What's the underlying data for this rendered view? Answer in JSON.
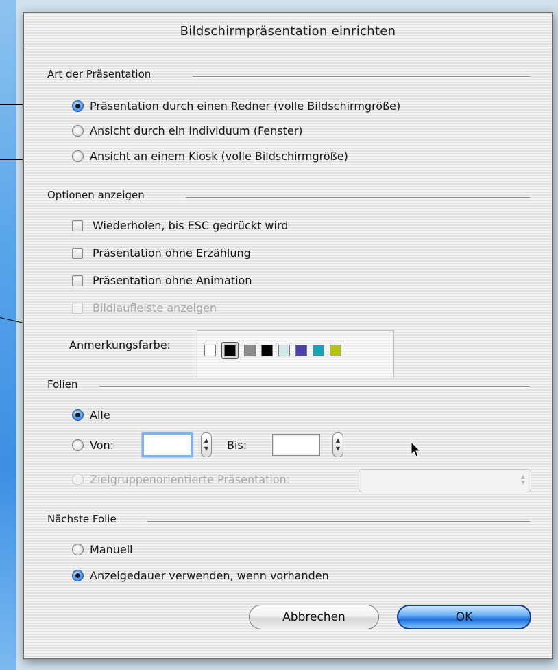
{
  "dialog": {
    "title": "Bildschirmpräsentation einrichten"
  },
  "presentation_type": {
    "title": "Art der Präsentation",
    "options": [
      {
        "label": "Präsentation durch einen Redner (volle Bildschirmgröße)",
        "checked": true
      },
      {
        "label": "Ansicht durch ein Individuum (Fenster)",
        "checked": false
      },
      {
        "label": "Ansicht an einem Kiosk (volle Bildschirmgröße)",
        "checked": false
      }
    ]
  },
  "display_options": {
    "title": "Optionen anzeigen",
    "checkboxes": [
      {
        "label": "Wiederholen, bis ESC gedrückt wird",
        "checked": false,
        "enabled": true
      },
      {
        "label": "Präsentation ohne Erzählung",
        "checked": false,
        "enabled": true
      },
      {
        "label": "Präsentation ohne Animation",
        "checked": false,
        "enabled": true
      },
      {
        "label": "Bildlaufleiste anzeigen",
        "checked": false,
        "enabled": false
      }
    ],
    "annotation_color_label": "Anmerkungsfarbe:",
    "annotation_colors": [
      "#ffffff",
      "#000000",
      "#8c8c8c",
      "#000000",
      "#cfeae6",
      "#4a40a8",
      "#18a3b0",
      "#b5c21a"
    ],
    "selected_color_index": 1
  },
  "slides": {
    "title": "Folien",
    "all_label": "Alle",
    "from_label": "Von:",
    "to_label": "Bis:",
    "from_value": "",
    "to_value": "",
    "custom_show_label": "Zielgruppenorientierte Präsentation:",
    "custom_show_value": "",
    "selected": "all"
  },
  "advance": {
    "title": "Nächste Folie",
    "manual_label": "Manuell",
    "timings_label": "Anzeigedauer verwenden, wenn vorhanden",
    "selected": "timings"
  },
  "buttons": {
    "cancel_label": "Abbrechen",
    "ok_label": "OK"
  },
  "colors": {
    "ok_button": "#1d6fdc",
    "selected_radio": "#1b6fd6",
    "focus_ring": "#7fb2ec"
  }
}
